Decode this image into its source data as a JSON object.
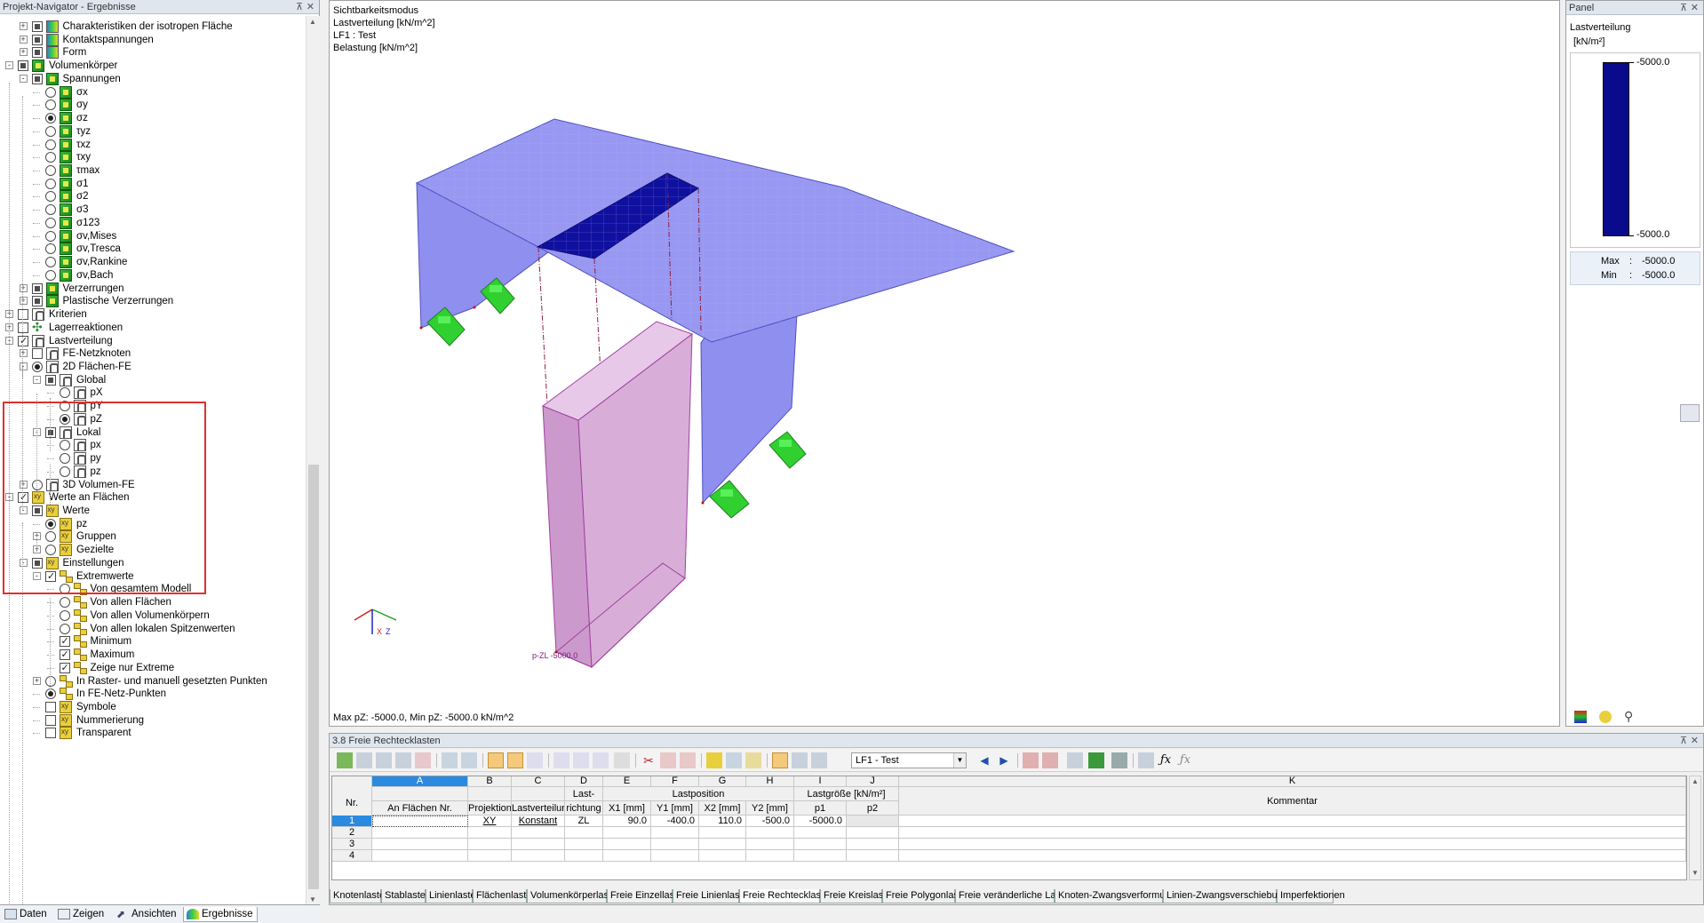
{
  "navigator": {
    "title": "Projekt-Navigator - Ergebnisse",
    "items": [
      {
        "label": "Charakteristiken der isotropen Fläche",
        "level": 2,
        "exp": "+",
        "ctl": "partial",
        "icon": "surf"
      },
      {
        "label": "Kontaktspannungen",
        "level": 2,
        "exp": "+",
        "ctl": "partial",
        "icon": "surf"
      },
      {
        "label": "Form",
        "level": 2,
        "exp": "+",
        "ctl": "partial",
        "icon": "surf"
      },
      {
        "label": "Volumenkörper",
        "level": 1,
        "exp": "-",
        "ctl": "partial",
        "icon": "cube"
      },
      {
        "label": "Spannungen",
        "level": 2,
        "exp": "-",
        "ctl": "partial",
        "icon": "cube"
      },
      {
        "label": "σx",
        "level": 3,
        "ctl": "radio",
        "icon": "cube"
      },
      {
        "label": "σy",
        "level": 3,
        "ctl": "radio",
        "icon": "cube"
      },
      {
        "label": "σz",
        "level": 3,
        "ctl": "radio-checked",
        "icon": "cube"
      },
      {
        "label": "τyz",
        "level": 3,
        "ctl": "radio",
        "icon": "cube"
      },
      {
        "label": "τxz",
        "level": 3,
        "ctl": "radio",
        "icon": "cube"
      },
      {
        "label": "τxy",
        "level": 3,
        "ctl": "radio",
        "icon": "cube"
      },
      {
        "label": "τmax",
        "level": 3,
        "ctl": "radio",
        "icon": "cube"
      },
      {
        "label": "σ1",
        "level": 3,
        "ctl": "radio",
        "icon": "cube"
      },
      {
        "label": "σ2",
        "level": 3,
        "ctl": "radio",
        "icon": "cube"
      },
      {
        "label": "σ3",
        "level": 3,
        "ctl": "radio",
        "icon": "cube"
      },
      {
        "label": "σ123",
        "level": 3,
        "ctl": "radio",
        "icon": "cube"
      },
      {
        "label": "σv,Mises",
        "level": 3,
        "ctl": "radio",
        "icon": "cube"
      },
      {
        "label": "σv,Tresca",
        "level": 3,
        "ctl": "radio",
        "icon": "cube"
      },
      {
        "label": "σv,Rankine",
        "level": 3,
        "ctl": "radio",
        "icon": "cube"
      },
      {
        "label": "σv,Bach",
        "level": 3,
        "ctl": "radio",
        "icon": "cube"
      },
      {
        "label": "Verzerrungen",
        "level": 2,
        "exp": "+",
        "ctl": "partial",
        "icon": "cube"
      },
      {
        "label": "Plastische Verzerrungen",
        "level": 2,
        "exp": "+",
        "ctl": "partial",
        "icon": "cube"
      },
      {
        "label": "Kriterien",
        "level": 1,
        "exp": "+",
        "ctl": "empty",
        "icon": "load"
      },
      {
        "label": "Lagerreaktionen",
        "level": 1,
        "exp": "+",
        "ctl": "empty",
        "icon": "react"
      },
      {
        "label": "Lastverteilung",
        "level": 1,
        "exp": "-",
        "ctl": "checked",
        "icon": "load"
      },
      {
        "label": "FE-Netzknoten",
        "level": 2,
        "exp": "+",
        "ctl": "empty",
        "icon": "load"
      },
      {
        "label": "2D Flächen-FE",
        "level": 2,
        "exp": "-",
        "ctl": "radio-checked",
        "icon": "load"
      },
      {
        "label": "Global",
        "level": 3,
        "exp": "-",
        "ctl": "partial",
        "icon": "load"
      },
      {
        "label": "pX",
        "level": 4,
        "ctl": "radio",
        "icon": "load"
      },
      {
        "label": "pY",
        "level": 4,
        "ctl": "radio",
        "icon": "load"
      },
      {
        "label": "pZ",
        "level": 4,
        "ctl": "radio-checked",
        "icon": "load"
      },
      {
        "label": "Lokal",
        "level": 3,
        "exp": "-",
        "ctl": "partial",
        "icon": "load"
      },
      {
        "label": "px",
        "level": 4,
        "ctl": "radio",
        "icon": "load"
      },
      {
        "label": "py",
        "level": 4,
        "ctl": "radio",
        "icon": "load"
      },
      {
        "label": "pz",
        "level": 4,
        "ctl": "radio",
        "icon": "load"
      },
      {
        "label": "3D Volumen-FE",
        "level": 2,
        "exp": "+",
        "ctl": "radio",
        "icon": "load"
      },
      {
        "label": "Werte an Flächen",
        "level": 1,
        "exp": "-",
        "ctl": "checked",
        "icon": "val"
      },
      {
        "label": "Werte",
        "level": 2,
        "exp": "-",
        "ctl": "partial",
        "icon": "val"
      },
      {
        "label": "pz",
        "level": 3,
        "ctl": "radio-checked",
        "icon": "val"
      },
      {
        "label": "Gruppen",
        "level": 3,
        "exp": "+",
        "ctl": "radio",
        "icon": "val"
      },
      {
        "label": "Gezielte",
        "level": 3,
        "exp": "+",
        "ctl": "radio",
        "icon": "val"
      },
      {
        "label": "Einstellungen",
        "level": 2,
        "exp": "-",
        "ctl": "partial",
        "icon": "val"
      },
      {
        "label": "Extremwerte",
        "level": 3,
        "exp": "-",
        "ctl": "checked",
        "icon": "ext"
      },
      {
        "label": "Von gesamtem Modell",
        "level": 4,
        "ctl": "radio",
        "icon": "ext"
      },
      {
        "label": "Von allen Flächen",
        "level": 4,
        "ctl": "radio",
        "icon": "ext"
      },
      {
        "label": "Von allen Volumenkörpern",
        "level": 4,
        "ctl": "radio",
        "icon": "ext"
      },
      {
        "label": "Von allen lokalen Spitzenwerten",
        "level": 4,
        "ctl": "radio",
        "icon": "ext"
      },
      {
        "label": "Minimum",
        "level": 4,
        "ctl": "checked",
        "icon": "ext"
      },
      {
        "label": "Maximum",
        "level": 4,
        "ctl": "checked",
        "icon": "ext"
      },
      {
        "label": "Zeige nur Extreme",
        "level": 4,
        "ctl": "checked",
        "icon": "ext"
      },
      {
        "label": "In Raster- und manuell gesetzten Punkten",
        "level": 3,
        "exp": "+",
        "ctl": "radio",
        "icon": "ext"
      },
      {
        "label": "In FE-Netz-Punkten",
        "level": 3,
        "ctl": "radio-checked",
        "icon": "ext"
      },
      {
        "label": "Symbole",
        "level": 3,
        "ctl": "empty",
        "icon": "val"
      },
      {
        "label": "Nummerierung",
        "level": 3,
        "ctl": "empty",
        "icon": "val"
      },
      {
        "label": "Transparent",
        "level": 3,
        "ctl": "empty",
        "icon": "val"
      }
    ],
    "tabs": [
      "Daten",
      "Zeigen",
      "Ansichten",
      "Ergebnisse"
    ]
  },
  "viewport": {
    "info_lines": [
      "Sichtbarkeitsmodus",
      "Lastverteilung [kN/m^2]",
      "LF1 : Test",
      "Belastung [kN/m^2]"
    ],
    "bottom_text": "Max pZ: -5000.0, Min pZ: -5000.0 kN/m^2",
    "label_pzl": "p-ZL -5000.0",
    "axis_x": "X",
    "axis_z": "Z"
  },
  "panel": {
    "title": "Panel",
    "heading": "Lastverteilung",
    "unit": "[kN/m²]",
    "scale_top": "-5000.0",
    "scale_bottom": "-5000.0",
    "max_label": "Max",
    "max_value": "-5000.0",
    "min_label": "Min",
    "min_value": "-5000.0",
    "bar_color": "#0a0a8c"
  },
  "table": {
    "title": "3.8 Freie Rechtecklasten",
    "loadcase": "LF1 - Test",
    "col_letters": [
      "A",
      "B",
      "C",
      "D",
      "E",
      "F",
      "G",
      "H",
      "I",
      "J",
      "K"
    ],
    "group_headers": {
      "lastrichtung": "Last-",
      "lastposition": "Lastposition",
      "lastgroesse": "Lastgröße [kN/m²]"
    },
    "headers": [
      "Nr.",
      "An Flächen Nr.",
      "Projektion",
      "Lastverteilung",
      "richtung",
      "X1 [mm]",
      "Y1 [mm]",
      "X2 [mm]",
      "Y2 [mm]",
      "p1",
      "p2",
      "Kommentar"
    ],
    "rows": [
      {
        "nr": "1",
        "flaechen": "",
        "projektion": "XY",
        "verteilung": "Konstant",
        "richtung": "ZL",
        "x1": "90.0",
        "y1": "-400.0",
        "x2": "110.0",
        "y2": "-500.0",
        "p1": "-5000.0",
        "p2": "",
        "kommentar": ""
      },
      {
        "nr": "2"
      },
      {
        "nr": "3"
      },
      {
        "nr": "4"
      }
    ],
    "sheet_tabs": [
      "Knotenlasten",
      "Stablasten",
      "Linienlasten",
      "Flächenlasten",
      "Volumenkörperlasten",
      "Freie Einzellasten",
      "Freie Linienlasten",
      "Freie Rechtecklasten",
      "Freie Kreislasten",
      "Freie Polygonlasten",
      "Freie veränderliche Lasten",
      "Knoten-Zwangsverformungen",
      "Linien-Zwangsverschiebungen",
      "Imperfektionen"
    ],
    "active_tab": "Freie Rechtecklasten"
  }
}
